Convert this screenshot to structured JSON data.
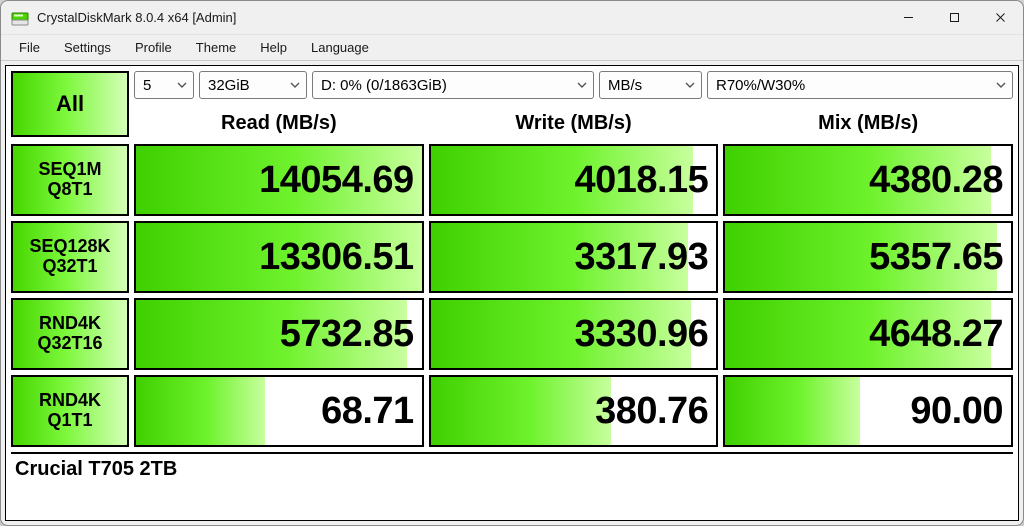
{
  "window": {
    "title": "CrystalDiskMark 8.0.4 x64 [Admin]"
  },
  "menu": {
    "file": "File",
    "settings": "Settings",
    "profile": "Profile",
    "theme": "Theme",
    "help": "Help",
    "language": "Language"
  },
  "controls": {
    "all_label": "All",
    "runs": "5",
    "size": "32GiB",
    "drive": "D: 0% (0/1863GiB)",
    "unit": "MB/s",
    "mix": "R70%/W30%"
  },
  "columns": {
    "read": "Read (MB/s)",
    "write": "Write (MB/s)",
    "mix": "Mix (MB/s)"
  },
  "tests": [
    {
      "l1": "SEQ1M",
      "l2": "Q8T1"
    },
    {
      "l1": "SEQ128K",
      "l2": "Q32T1"
    },
    {
      "l1": "RND4K",
      "l2": "Q32T16"
    },
    {
      "l1": "RND4K",
      "l2": "Q1T1"
    }
  ],
  "results": {
    "read": [
      "14054.69",
      "13306.51",
      "5732.85",
      "68.71"
    ],
    "write": [
      "4018.15",
      "3317.93",
      "3330.96",
      "380.76"
    ],
    "mix": [
      "4380.28",
      "5357.65",
      "4648.27",
      "90.00"
    ]
  },
  "bar_pct": {
    "read": [
      100,
      100,
      95,
      45
    ],
    "write": [
      92,
      90,
      91,
      63
    ],
    "mix": [
      93,
      95,
      93,
      47
    ]
  },
  "drive_name": "Crucial T705 2TB"
}
